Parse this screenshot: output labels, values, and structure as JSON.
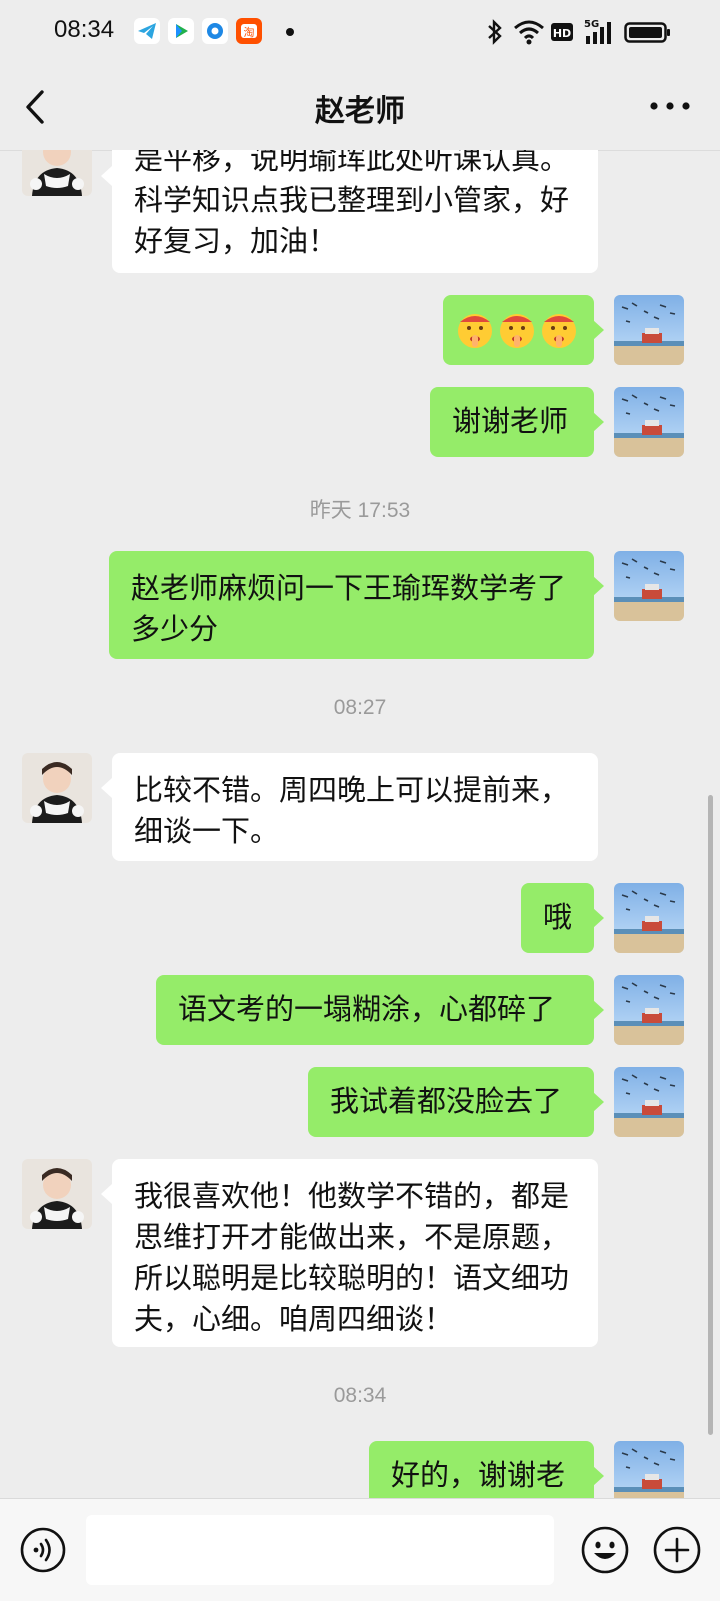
{
  "status_bar": {
    "time": "08:34",
    "icons_left": [
      "telegram-icon",
      "video-app-icon",
      "qq-browser-icon",
      "taobao-icon",
      "dot-icon"
    ],
    "icons_right": [
      "bluetooth-icon",
      "wifi-icon",
      "hd-icon",
      "signal-5g-icon",
      "battery-icon"
    ],
    "hd_label": "HD",
    "network_label": "5G"
  },
  "header": {
    "title": "赵老师",
    "back_icon": "chevron-left-icon",
    "more_icon": "more-dots-icon"
  },
  "messages": [
    {
      "sender": "teacher",
      "text": "是平移，说明瑜珲此处听课认真。\n科学知识点我已整理到小管家，好\n好复习，加油！"
    },
    {
      "sender": "me",
      "text": "🤫🤫🤫",
      "note": "emoji"
    },
    {
      "sender": "me",
      "text": "谢谢老师"
    },
    {
      "type": "timestamp",
      "text": "昨天 17:53"
    },
    {
      "sender": "me",
      "text": "赵老师麻烦问一下王瑜珲数学考了\n多少分"
    },
    {
      "type": "timestamp",
      "text": "08:27"
    },
    {
      "sender": "teacher",
      "text": "比较不错。周四晚上可以提前来，\n细谈一下。"
    },
    {
      "sender": "me",
      "text": "哦"
    },
    {
      "sender": "me",
      "text": "语文考的一塌糊涂，心都碎了"
    },
    {
      "sender": "me",
      "text": "我试着都没脸去了"
    },
    {
      "sender": "teacher",
      "text": "我很喜欢他！他数学不错的，都是\n思维打开才能做出来，不是原题，\n所以聪明是比较聪明的！语文细功\n夫，心细。咱周四细谈！"
    },
    {
      "type": "timestamp",
      "text": "08:34"
    },
    {
      "sender": "me",
      "text": "好的，谢谢老",
      "note": "partially visible"
    }
  ],
  "input_bar": {
    "voice_icon": "voice-icon",
    "emoji_icon": "emoji-icon",
    "plus_icon": "plus-icon",
    "value": ""
  },
  "colors": {
    "background": "#ededed",
    "outgoing_bubble": "#95ec69",
    "incoming_bubble": "#ffffff",
    "timestamp": "#9a9a9a"
  }
}
